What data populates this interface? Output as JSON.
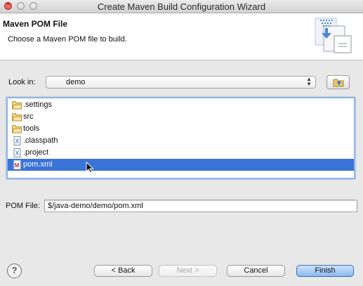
{
  "window": {
    "title": "Create Maven Build Configuration Wizard"
  },
  "header": {
    "title": "Maven POM File",
    "description": "Choose a Maven POM file to build.",
    "banner_icon": "wizard-banner-icon"
  },
  "lookin": {
    "label": "Look in:",
    "value": "demo",
    "folder_button_icon": "folder-up-icon"
  },
  "files": [
    {
      "name": ".settings",
      "icon": "folder-icon",
      "selected": false
    },
    {
      "name": "src",
      "icon": "folder-icon",
      "selected": false
    },
    {
      "name": "tools",
      "icon": "folder-icon",
      "selected": false
    },
    {
      "name": ".classpath",
      "icon": "xml-file-icon",
      "selected": false
    },
    {
      "name": ".project",
      "icon": "xml-file-icon",
      "selected": false
    },
    {
      "name": "pom.xml",
      "icon": "maven-file-icon",
      "selected": true
    }
  ],
  "pom": {
    "label": "POM File:",
    "value": "$/java-demo/demo/pom.xml"
  },
  "buttons": {
    "back": "< Back",
    "next": "Next >",
    "cancel": "Cancel",
    "finish": "Finish",
    "help_icon": "?"
  },
  "colors": {
    "selection": "#3b74d8",
    "default_button": "#8db8ef"
  }
}
